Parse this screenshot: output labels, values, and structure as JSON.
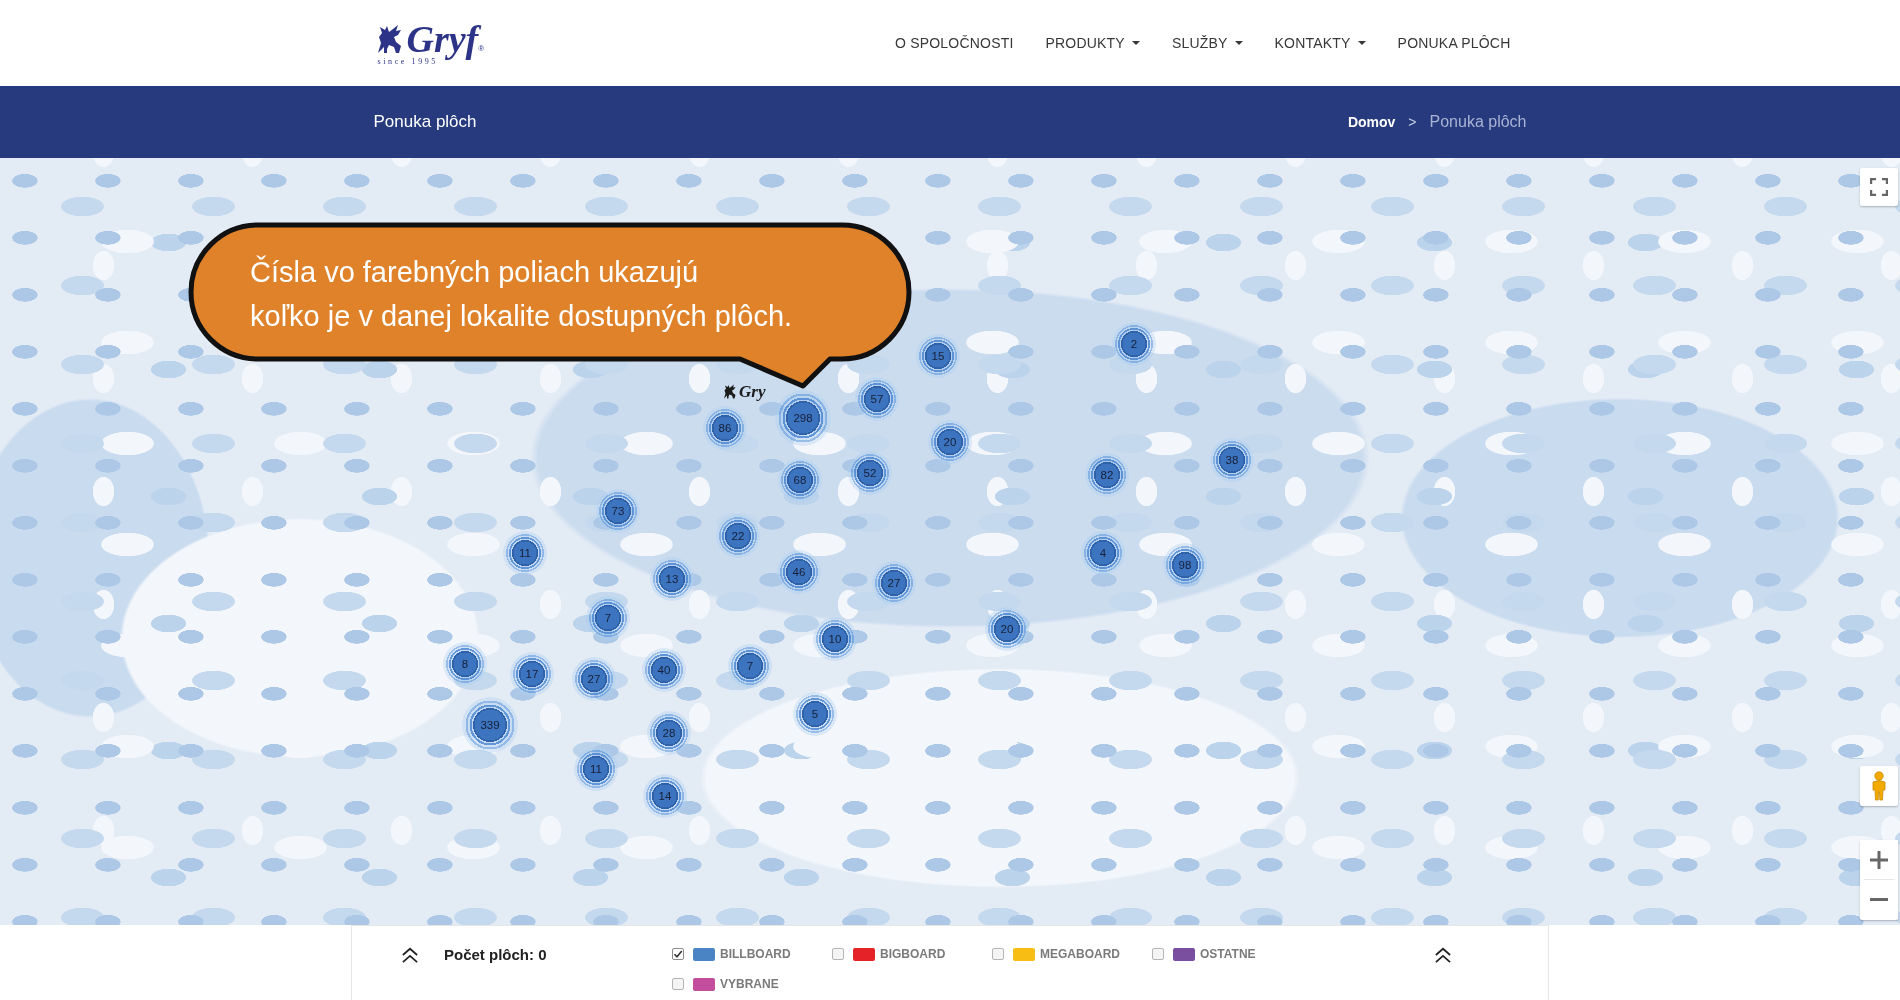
{
  "header": {
    "logo": {
      "name": "Gryf",
      "registered_mark": "®",
      "tagline": "since 1995"
    },
    "nav": [
      {
        "label": "O SPOLOČNOSTI",
        "dropdown": false
      },
      {
        "label": "PRODUKTY",
        "dropdown": true
      },
      {
        "label": "SLUŽBY",
        "dropdown": true
      },
      {
        "label": "KONTAKTY",
        "dropdown": true
      },
      {
        "label": "PONUKA PLÔCH",
        "dropdown": false
      }
    ]
  },
  "title_bar": {
    "title": "Ponuka plôch",
    "breadcrumb": {
      "separator": ">",
      "items": [
        {
          "label": "Domov",
          "current": false
        },
        {
          "label": "Ponuka plôch",
          "current": true
        }
      ]
    }
  },
  "map": {
    "callout": {
      "text": "Čísla vo farebných poliach ukazujú\nkoľko je v danej lokalite dostupných plôch."
    },
    "logo_marker": {
      "name": "Gry"
    },
    "clusters": [
      {
        "count": "15"
      },
      {
        "count": "2"
      },
      {
        "count": "57"
      },
      {
        "count": "86"
      },
      {
        "count": "298"
      },
      {
        "count": "20"
      },
      {
        "count": "38"
      },
      {
        "count": "68"
      },
      {
        "count": "52"
      },
      {
        "count": "82"
      },
      {
        "count": "73"
      },
      {
        "count": "22"
      },
      {
        "count": "11"
      },
      {
        "count": "4"
      },
      {
        "count": "98"
      },
      {
        "count": "13"
      },
      {
        "count": "46"
      },
      {
        "count": "27"
      },
      {
        "count": "7"
      },
      {
        "count": "10"
      },
      {
        "count": "20"
      },
      {
        "count": "8"
      },
      {
        "count": "17"
      },
      {
        "count": "27"
      },
      {
        "count": "40"
      },
      {
        "count": "7"
      },
      {
        "count": "339"
      },
      {
        "count": "5"
      },
      {
        "count": "28"
      },
      {
        "count": "11"
      },
      {
        "count": "14"
      }
    ]
  },
  "legend_panel": {
    "count_label": "Počet plôch: 0",
    "filters": [
      {
        "label": "BILLBOARD",
        "checked": true,
        "color": "#4a84c4"
      },
      {
        "label": "BIGBOARD",
        "checked": false,
        "color": "#e52227"
      },
      {
        "label": "MEGABOARD",
        "checked": false,
        "color": "#f7bd15"
      },
      {
        "label": "OSTATNE",
        "checked": false,
        "color": "#7a4fa0"
      },
      {
        "label": "VYBRANE",
        "checked": false,
        "color": "#c34e9e"
      }
    ]
  }
}
